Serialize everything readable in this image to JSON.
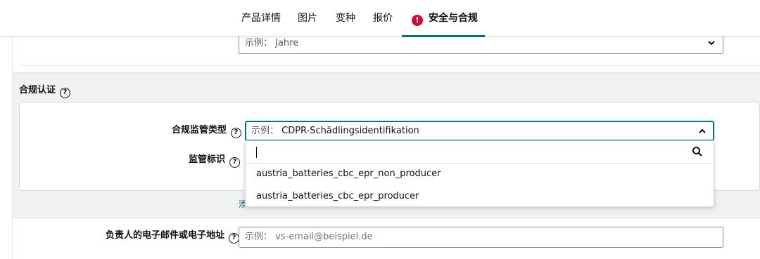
{
  "tabs": [
    {
      "label": "产品详情"
    },
    {
      "label": "图片"
    },
    {
      "label": "变种"
    },
    {
      "label": "报价"
    },
    {
      "label": "安全与合规",
      "active": true,
      "alert": "!"
    }
  ],
  "top_field": {
    "placeholder": "示例： Jahre"
  },
  "compliance": {
    "section_title": "合规认证",
    "help_glyph": "?",
    "type_label": "合规监管类型",
    "type_select_prefix": "示例：",
    "type_select_value": "CDPR-Schädlingsidentifikation",
    "ident_label": "监管标识",
    "dropdown_options": [
      "austria_batteries_cbc_epr_non_producer",
      "austria_batteries_cbc_epr_producer"
    ],
    "add_link_partial": "添"
  },
  "email": {
    "label": "负责人的电子邮件或电子地址",
    "prefix": "示例：",
    "placeholder": "vs-email@beispiel.de"
  },
  "colors": {
    "accent": "#007185",
    "alert": "#cc0c39",
    "section_bg": "#f0f2f2"
  }
}
